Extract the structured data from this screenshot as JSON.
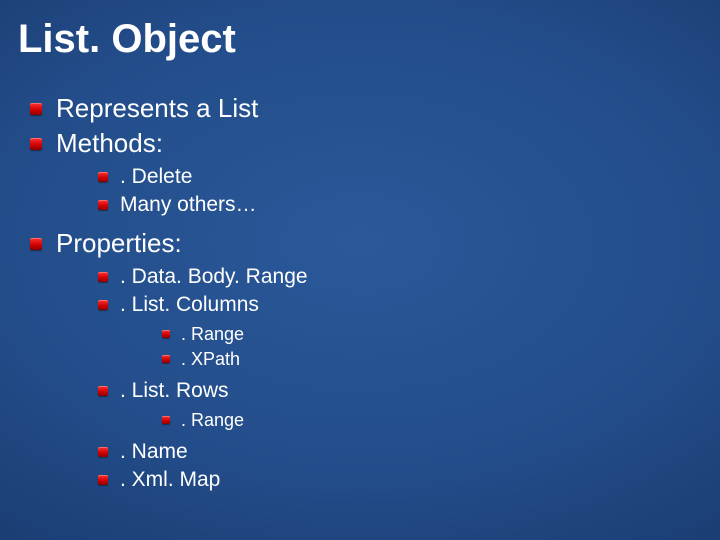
{
  "title": "List. Object",
  "l1": {
    "a": "Represents a List",
    "b": "Methods:",
    "c": "Properties:"
  },
  "methods": {
    "a": ". Delete",
    "b": "Many others…"
  },
  "props": {
    "a": ". Data. Body. Range",
    "b": ". List. Columns",
    "c": ". List. Rows",
    "d": ". Name",
    "e": ". Xml. Map"
  },
  "listcols": {
    "a": ". Range",
    "b": ". XPath"
  },
  "listrows": {
    "a": ". Range"
  }
}
